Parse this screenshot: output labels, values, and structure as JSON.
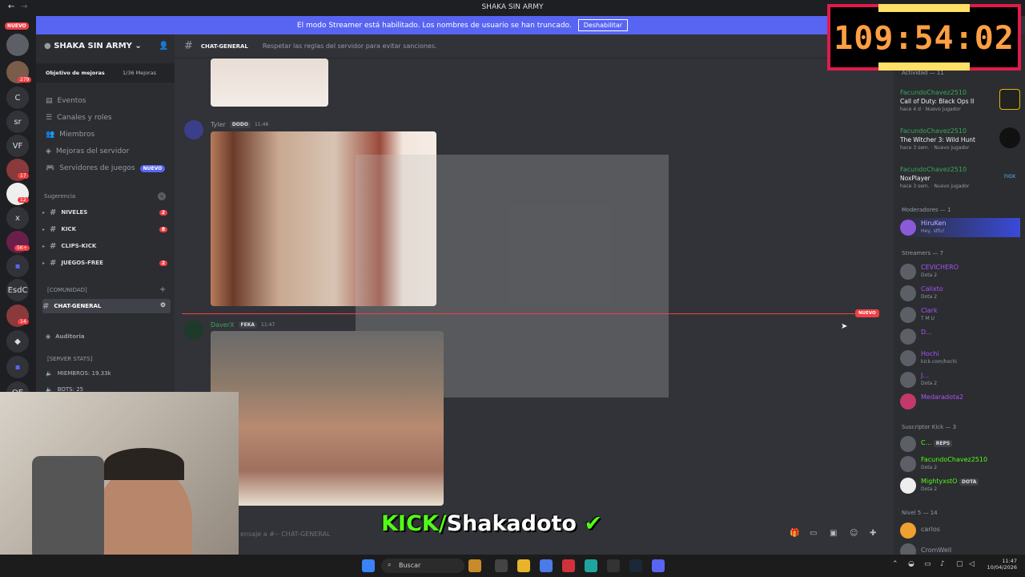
{
  "window": {
    "title": "SHAKA SIN ARMY"
  },
  "banner": {
    "text": "El modo Streamer está habilitado. Los nombres de usuario se han truncado.",
    "button": "Deshabilitar"
  },
  "rail": {
    "new_label": "NUEVO",
    "count_279": "279",
    "letters": [
      "C",
      "sr",
      "VF",
      "x",
      "EsdC",
      "OE"
    ],
    "badges": [
      "17",
      "12",
      "5K+",
      "14"
    ]
  },
  "sidebar": {
    "server_name": "SHAKA SIN ARMY",
    "boost_goal": "Objetivo de mejoras",
    "boost_progress": "1/36 Mejoras",
    "items": [
      {
        "label": "Eventos"
      },
      {
        "label": "Canales y roles"
      },
      {
        "label": "Miembros"
      },
      {
        "label": "Mejoras del servidor"
      },
      {
        "label": "Servidores de juegos",
        "badge": "NUEVO"
      }
    ],
    "category_suggest": "Sugerencia",
    "channels": [
      {
        "label": "NIVELES",
        "count": "2"
      },
      {
        "label": "KICK",
        "count": "8"
      },
      {
        "label": "CLIPS-KICK",
        "count": ""
      },
      {
        "label": "JUEGOS-FREE",
        "count": "2"
      }
    ],
    "category_community": "[COMUNIDAD]",
    "active_channel": "CHAT-GENERAL",
    "audit": "Auditoria",
    "server_stats": "[SERVER STATS]",
    "members_stat": "MIEMBROS: 19.33k",
    "bots_stat": "BOTS: 25"
  },
  "header": {
    "channel": "CHAT-GENERAL",
    "topic": "Respetar las reglas del servidor para evitar sanciones."
  },
  "messages": [
    {
      "author": "Tyler",
      "tag": "DODO",
      "time": "11:46"
    },
    {
      "author": "DaverX",
      "tag": "FEKA",
      "time": "11:47"
    }
  ],
  "new_label": "NUEVO",
  "composer": {
    "placeholder": "ensaje a #-- CHAT-GENERAL"
  },
  "overlay": {
    "kick_prefix": "KICK/",
    "kick_name": "Shakadoto"
  },
  "timer": {
    "value": "109:54:02"
  },
  "members": {
    "activity_header": "Actividad — 11",
    "activities": [
      {
        "name": "FacundoChavez2510",
        "game": "Call of Duty: Black Ops II",
        "meta1": "hace 4 d",
        "meta2": "Nuevo jugador"
      },
      {
        "name": "FacundoChavez2510",
        "game": "The Witcher 3: Wild Hunt",
        "meta1": "hace 3 sem.",
        "meta2": "Nuevo jugador"
      },
      {
        "name": "FacundoChavez2510",
        "game": "NoxPlayer",
        "meta1": "hace 3 sem.",
        "meta2": "Nuevo jugador"
      }
    ],
    "mods_header": "Moderadores — 1",
    "mod": {
      "name": "HiruKen",
      "sub": "Hey, stfu!"
    },
    "streamers_header": "Streamers — 7",
    "streamers": [
      {
        "name": "CEVICHERO",
        "sub": "Dota 2",
        "color": "#a855f7"
      },
      {
        "name": "Calixto",
        "sub": "Dota 2",
        "color": "#a855f7"
      },
      {
        "name": "Clark",
        "sub": "T M U",
        "color": "#a855f7"
      },
      {
        "name": "D...",
        "sub": "",
        "color": "#a855f7"
      },
      {
        "name": "Hochi",
        "sub": "kick.com/hochi",
        "color": "#a855f7"
      },
      {
        "name": "J...",
        "sub": "Dota 2",
        "color": "#a855f7"
      },
      {
        "name": "Medaradota2",
        "sub": "",
        "color": "#a855f7"
      }
    ],
    "subs_header": "Suscriptor Kick — 3",
    "subs": [
      {
        "name": "C...",
        "tag": "REPS",
        "sub": ""
      },
      {
        "name": "FacundoChavez2510",
        "tag": "",
        "sub": "Dota 2"
      },
      {
        "name": "MightyxstO",
        "tag": "DOTA",
        "sub": "Dota 2"
      }
    ],
    "level_header": "Nivel 5 — 14",
    "level_members": [
      {
        "name": "carlos"
      },
      {
        "name": "CromWell"
      }
    ]
  },
  "taskbar": {
    "search": "Buscar",
    "time": "11:47",
    "date": "10/04/2026"
  }
}
